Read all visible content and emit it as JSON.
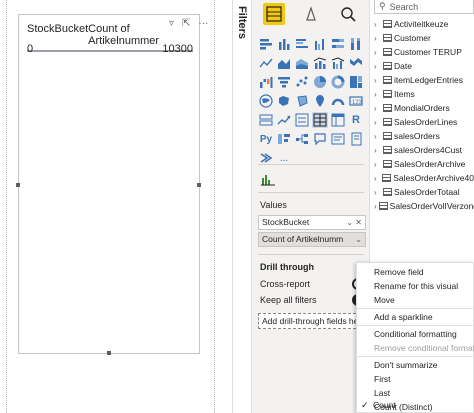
{
  "visual": {
    "columns": [
      "StockBucket",
      "Count of Artikelnummer"
    ],
    "row": [
      "0",
      "10300"
    ]
  },
  "filters_label": "Filters",
  "viz_pane": {
    "values_label": "Values",
    "wells": [
      "StockBucket",
      "Count of Artikelnumm"
    ],
    "drill_title": "Drill through",
    "cross_report_label": "Cross-report",
    "keep_filters_label": "Keep all filters",
    "drop_placeholder": "Add drill-through fields here",
    "more_label": "..."
  },
  "fields": {
    "search_placeholder": "Search",
    "items": [
      "Activiteitkeuze",
      "Customer",
      "Customer TERUP",
      "Date",
      "itemLedgerEntries",
      "Items",
      "MondialOrders",
      "SalesOrderLines",
      "salesOrders",
      "salesOrders4Cust",
      "SalesOrderArchive",
      "SalesOrderArchive40",
      "SalesOrderTotaal",
      "SalesOrderVolIVerzonden"
    ]
  },
  "context_menu": {
    "items": [
      "Remove field",
      "Rename for this visual",
      "Move",
      "Add a sparkline",
      "Conditional formatting",
      "Remove conditional formatting",
      "Don't summarize",
      "First",
      "Last",
      "Count (Distinct)",
      "Count"
    ],
    "checked": "Count"
  }
}
